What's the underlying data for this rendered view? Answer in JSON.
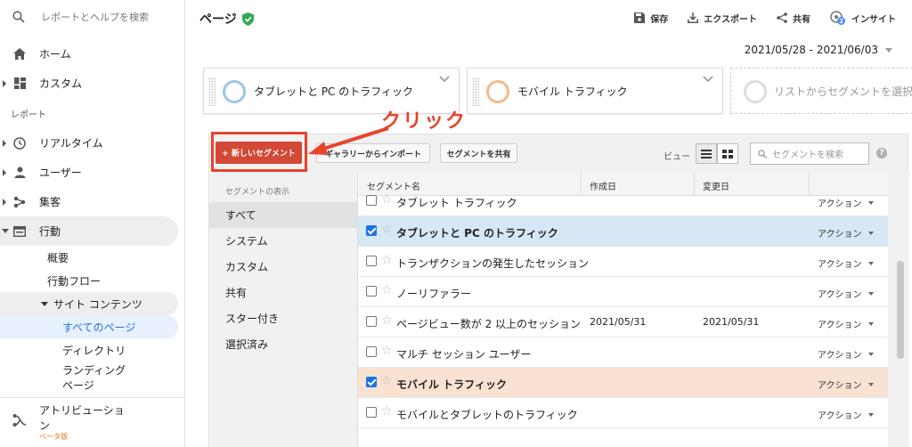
{
  "sidebar": {
    "search_placeholder": "レポートとヘルプを検索",
    "home": "ホーム",
    "custom": "カスタム",
    "reports_section": "レポート",
    "realtime": "リアルタイム",
    "users": "ユーザー",
    "acquisition": "集客",
    "behavior": "行動",
    "overview": "概要",
    "behavior_flow": "行動フロー",
    "site_content": "サイト コンテンツ",
    "all_pages": "すべてのページ",
    "directory": "ディレクトリ",
    "landing_pages": "ランディング ページ",
    "attribution": "アトリビューション",
    "beta": "ベータ版"
  },
  "header": {
    "title": "ページ",
    "save": "保存",
    "export": "エクスポート",
    "share": "共有",
    "insights": "インサイト",
    "insights_badge": "2",
    "date_range": "2021/05/28 - 2021/06/03"
  },
  "segments": {
    "card1": "タブレットと PC のトラフィック",
    "card2": "モバイル トラフィック",
    "card3_placeholder": "リストからセグメントを選択"
  },
  "toolbar": {
    "new_segment": "+ 新しいセグメント",
    "import_gallery": "ギャラリーからインポート",
    "share_segments": "セグメントを共有",
    "view_label": "ビュー",
    "search_placeholder": "セグメントを検索",
    "help": "?"
  },
  "filters": {
    "title": "セグメントの表示",
    "items": [
      "すべて",
      "システム",
      "カスタム",
      "共有",
      "スター付き",
      "選択済み"
    ]
  },
  "table": {
    "headers": [
      "セグメント名",
      "作成日",
      "変更日"
    ],
    "action_label": "アクション",
    "rows": [
      {
        "name": "タブレット トラフィック",
        "created": "",
        "modified": ""
      },
      {
        "name": "タブレットと PC のトラフィック",
        "created": "",
        "modified": ""
      },
      {
        "name": "トランザクションの発生したセッション",
        "created": "",
        "modified": ""
      },
      {
        "name": "ノーリファラー",
        "created": "",
        "modified": ""
      },
      {
        "name": "ページビュー数が 2 以上のセッション",
        "created": "2021/05/31",
        "modified": "2021/05/31"
      },
      {
        "name": "マルチ セッション ユーザー",
        "created": "",
        "modified": ""
      },
      {
        "name": "モバイル トラフィック",
        "created": "",
        "modified": ""
      },
      {
        "name": "モバイルとタブレットのトラフィック",
        "created": "",
        "modified": ""
      }
    ]
  },
  "annotation": {
    "click_label": "クリック"
  },
  "colors": {
    "accent_red": "#d34836",
    "highlight_red": "#e8432c",
    "segment1_blue": "#9cc7e4",
    "segment2_orange": "#f4b98f",
    "selected_blue": "#d6e8f5",
    "selected_orange": "#f9e2d2"
  }
}
